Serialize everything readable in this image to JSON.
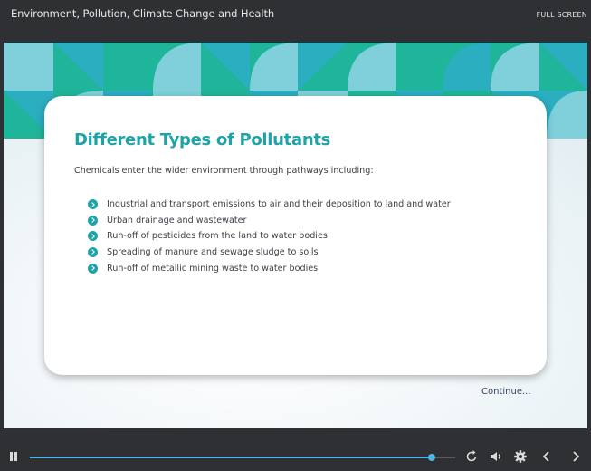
{
  "header": {
    "course_title": "Environment, Pollution, Climate Change and Health",
    "fullscreen_label": "FULL SCREEN"
  },
  "slide": {
    "heading": "Different Types of Pollutants",
    "intro": "Chemicals enter the wider environment through pathways including:",
    "bullets": [
      "Industrial and transport emissions to air and their deposition to land and water",
      "Urban drainage and wastewater",
      "Run-off of pesticides from the land to water bodies",
      "Spreading of manure and sewage sludge to soils",
      "Run-off of metallic mining waste to water bodies"
    ],
    "continue_label": "Continue...",
    "accent_color": "#1fa3a8",
    "banner_colors": [
      "#1fb59a",
      "#2aaec0",
      "#7fd0db"
    ]
  },
  "player": {
    "progress": 0.945,
    "progress_color": "#4fb6e8",
    "icons": [
      "pause-icon",
      "replay-icon",
      "volume-icon",
      "settings-icon",
      "prev-icon",
      "next-icon"
    ]
  }
}
